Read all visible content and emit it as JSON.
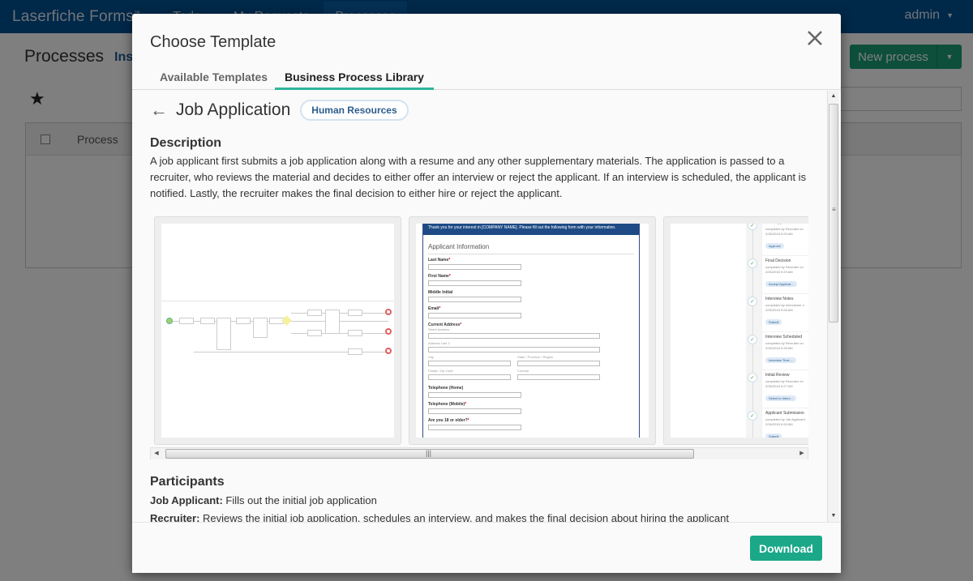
{
  "app": {
    "brand": "Laserfiche Forms",
    "brand_mark": "™",
    "nav": [
      "Todo",
      "My Requests",
      "Processes"
    ],
    "user": "admin"
  },
  "background_page": {
    "title": "Processes",
    "subtitle": "Ins",
    "new_process_label": "New process",
    "table_columns": [
      "Process"
    ]
  },
  "modal": {
    "title": "Choose Template",
    "tabs": [
      {
        "label": "Available Templates",
        "active": false
      },
      {
        "label": "Business Process Library",
        "active": true
      }
    ],
    "template": {
      "name": "Job Application",
      "category": "Human Resources",
      "description_heading": "Description",
      "description": "A job applicant first submits a job application along with a resume and any other supplementary materials. The application is passed to a recruiter, who reviews the material and decides to either offer an interview or reject the applicant. If an interview is scheduled, the applicant is notified. Lastly, the recruiter makes the final decision to either hire or reject the applicant.",
      "previews": {
        "form": {
          "header_text": "Thank you for your interest in [COMPANY NAME]. Please fill out the following form with your information.",
          "section": "Applicant Information",
          "fields": [
            {
              "label": "Last Name",
              "required": true
            },
            {
              "label": "First Name",
              "required": true
            },
            {
              "label": "Middle Initial",
              "required": false
            },
            {
              "label": "Email",
              "required": true
            },
            {
              "label": "Current Address",
              "required": true
            }
          ],
          "address_parts": [
            "Street Address",
            "Address Line 2",
            "City",
            "State / Province / Region",
            "Postal / Zip Code",
            "Country"
          ],
          "more_fields": [
            {
              "label": "Telephone (Home)",
              "required": false
            },
            {
              "label": "Telephone (Mobile)",
              "required": true
            },
            {
              "label": "Are you 18 or older?",
              "required": true
            }
          ]
        },
        "timeline": [
          {
            "title": "Final Applicant Details",
            "meta": "completed by Recruiter on",
            "date": "2/26/2018 9:29 AM",
            "action": "Approve"
          },
          {
            "title": "Final Decision",
            "meta": "completed by Recruiter on",
            "date": "2/26/2018 9:29 AM",
            "action": "Accept Applicat..."
          },
          {
            "title": "Interview Notes",
            "meta": "completed by Interviewer o",
            "date": "2/26/2018 9:28 AM",
            "action": "Submit"
          },
          {
            "title": "Interview Scheduled",
            "meta": "completed by Recruiter on",
            "date": "2/26/2018 9:28 AM",
            "action": "Interview Time ..."
          },
          {
            "title": "Initial Review",
            "meta": "completed by Recruiter on",
            "date": "2/26/2018 9:27 AM",
            "action": "Select to Interv..."
          },
          {
            "title": "Applicant Submission",
            "meta": "completed by Job Applicant",
            "date": "2/26/2018 9:26 AM",
            "action": "Submit"
          }
        ]
      },
      "participants_heading": "Participants",
      "participants": [
        {
          "role": "Job Applicant:",
          "text": " Fills out the initial job application"
        },
        {
          "role": "Recruiter:",
          "text": " Reviews the initial job application, schedules an interview, and makes the final decision about hiring the applicant"
        }
      ]
    },
    "download_label": "Download"
  },
  "colors": {
    "topbar": "#005193",
    "accent_green": "#1aa889",
    "tab_underline": "#2fb69b",
    "badge_text": "#2b5d8c"
  }
}
